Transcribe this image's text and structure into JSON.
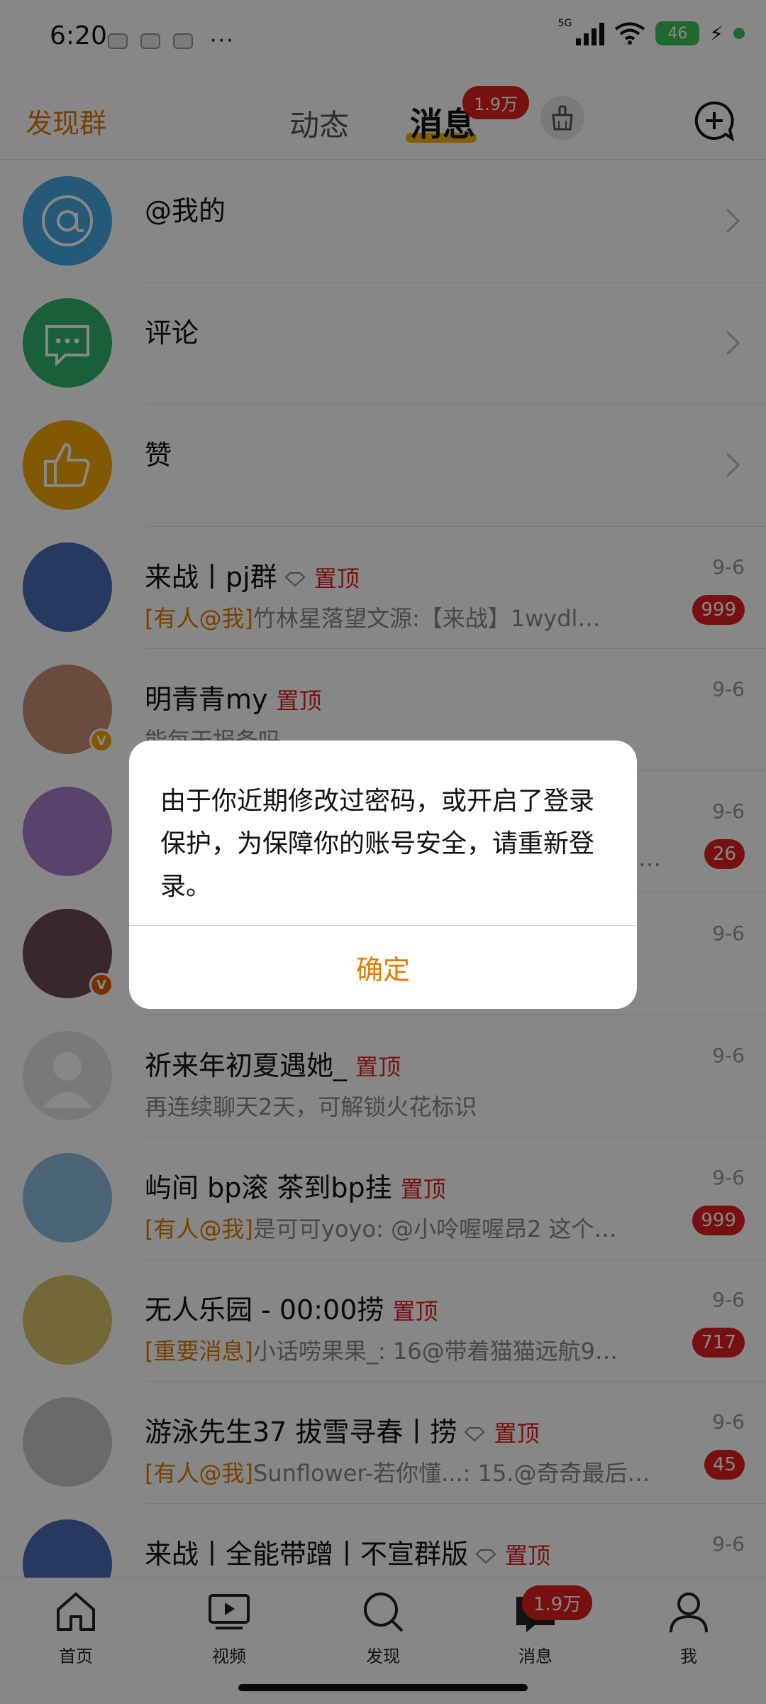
{
  "status_bar": {
    "time": "6:20",
    "more": "···",
    "network": "5G",
    "battery": "46",
    "charging_icon": "⚡"
  },
  "top_nav": {
    "discover_groups": "发现群",
    "tab_feed": "动态",
    "tab_messages": "消息",
    "messages_badge": "1.9万"
  },
  "shortcuts": [
    {
      "label": "@我的"
    },
    {
      "label": "评论"
    },
    {
      "label": "赞"
    }
  ],
  "conversations": [
    {
      "title": "来战丨pj群",
      "diamond": true,
      "pin": "置顶",
      "tag": "[有人@我]",
      "preview": "竹林星落望文源:【来战】1wydl…",
      "date": "9-6",
      "count": "999"
    },
    {
      "title": "明青青my",
      "diamond": false,
      "pin": "置顶",
      "tag": "",
      "preview": "能每天报备吗",
      "date": "9-6",
      "count": ""
    },
    {
      "title": "",
      "diamond": false,
      "pin": "",
      "tag": "",
      "preview": "…",
      "date": "9-6",
      "count": "26"
    },
    {
      "title": "",
      "diamond": false,
      "pin": "",
      "tag": "",
      "preview": "",
      "date": "9-6",
      "count": ""
    },
    {
      "title": "祈来年初夏遇她_",
      "diamond": false,
      "pin": "置顶",
      "tag": "",
      "preview": "再连续聊天2天，可解锁火花标识",
      "date": "9-6",
      "count": ""
    },
    {
      "title": "屿间  bp滚  茶到bp挂",
      "diamond": false,
      "pin": "置顶",
      "tag": "[有人@我]",
      "preview": "是可可yoyo: @小呤喔喔昂2 这个…",
      "date": "9-6",
      "count": "999"
    },
    {
      "title": "无人乐园 - 00:00捞",
      "diamond": false,
      "pin": "置顶",
      "tag": "[重要消息]",
      "preview": "小话唠果果_: 16@带着猫猫远航9…",
      "date": "9-6",
      "count": "717"
    },
    {
      "title": "游泳先生37 拔雪寻春丨捞",
      "diamond": true,
      "pin": "置顶",
      "tag": "[有人@我]",
      "preview": "Sunflower-若你懂...: 15.@奇奇最后…",
      "date": "9-6",
      "count": "45"
    },
    {
      "title": "来战丨全能带蹭丨不宣群版",
      "diamond": true,
      "pin": "置顶",
      "tag": "",
      "preview": "",
      "date": "9-6",
      "count": ""
    }
  ],
  "bottom_tabs": [
    {
      "label": "首页"
    },
    {
      "label": "视频"
    },
    {
      "label": "发现"
    },
    {
      "label": "消息"
    },
    {
      "label": "我"
    }
  ],
  "bottom_messages_badge": "1.9万",
  "dialog": {
    "message": "由于你近期修改过密码，或开启了登录保护，为保障你的账号安全，请重新登录。",
    "confirm": "确定"
  },
  "colors": {
    "accent_orange": "#e07b00",
    "badge_red": "#e02020",
    "overlay": "rgba(0,0,0,0.47)"
  }
}
